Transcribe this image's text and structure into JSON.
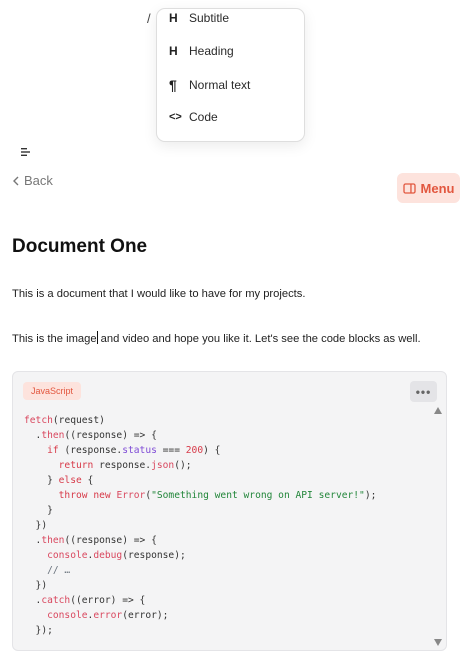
{
  "slash_text": "/",
  "block_menu": {
    "items": [
      {
        "icon_text": "H",
        "label": "Subtitle"
      },
      {
        "icon_text": "H",
        "label": "Heading"
      },
      {
        "icon_text": "¶",
        "label": "Normal text"
      },
      {
        "icon_text": "<>",
        "label": "Code"
      }
    ]
  },
  "nav": {
    "back_label": "Back",
    "menu_label": "Menu"
  },
  "document": {
    "title": "Document One",
    "paragraph_1": "This is a document that I would like to have for my projects.",
    "paragraph_2_before_caret": "This is the image",
    "paragraph_2_after_caret": " and video and hope you like it. Let's see the code blocks as well."
  },
  "code_block": {
    "language": "JavaScript",
    "more_label": "•••",
    "lines": [
      [
        [
          "fn",
          "fetch"
        ],
        [
          "pl",
          "(request)"
        ]
      ],
      [
        [
          "pl",
          "  ."
        ],
        [
          "fn",
          "then"
        ],
        [
          "pl",
          "((response) => {"
        ]
      ],
      [
        [
          "pl",
          "    "
        ],
        [
          "kw",
          "if"
        ],
        [
          "pl",
          " (response."
        ],
        [
          "prop",
          "status"
        ],
        [
          "pl",
          " === "
        ],
        [
          "num",
          "200"
        ],
        [
          "pl",
          ") {"
        ]
      ],
      [
        [
          "pl",
          "      "
        ],
        [
          "kw",
          "return"
        ],
        [
          "pl",
          " response."
        ],
        [
          "fn",
          "json"
        ],
        [
          "pl",
          "();"
        ]
      ],
      [
        [
          "pl",
          "    } "
        ],
        [
          "kw",
          "else"
        ],
        [
          "pl",
          " {"
        ]
      ],
      [
        [
          "pl",
          "      "
        ],
        [
          "kw",
          "throw"
        ],
        [
          "pl",
          " "
        ],
        [
          "kw",
          "new"
        ],
        [
          "pl",
          " "
        ],
        [
          "fn",
          "Error"
        ],
        [
          "pl",
          "("
        ],
        [
          "str",
          "\"Something went wrong on API server!\""
        ],
        [
          "pl",
          ");"
        ]
      ],
      [
        [
          "pl",
          "    }"
        ]
      ],
      [
        [
          "pl",
          "  })"
        ]
      ],
      [
        [
          "pl",
          "  ."
        ],
        [
          "fn",
          "then"
        ],
        [
          "pl",
          "((response) => {"
        ]
      ],
      [
        [
          "pl",
          "    "
        ],
        [
          "fn",
          "console"
        ],
        [
          "pl",
          "."
        ],
        [
          "fn",
          "debug"
        ],
        [
          "pl",
          "(response);"
        ]
      ],
      [
        [
          "pl",
          "    "
        ],
        [
          "cm",
          "// …"
        ]
      ],
      [
        [
          "pl",
          "  })"
        ]
      ],
      [
        [
          "pl",
          "  ."
        ],
        [
          "fn",
          "catch"
        ],
        [
          "pl",
          "((error) => {"
        ]
      ],
      [
        [
          "pl",
          "    "
        ],
        [
          "fn",
          "console"
        ],
        [
          "pl",
          "."
        ],
        [
          "fn",
          "error"
        ],
        [
          "pl",
          "(error);"
        ]
      ],
      [
        [
          "pl",
          "  });"
        ]
      ]
    ]
  },
  "colors": {
    "accent": "#e2573f",
    "accent_bg": "#fde3dd",
    "code_bg": "#f4f4f5"
  }
}
